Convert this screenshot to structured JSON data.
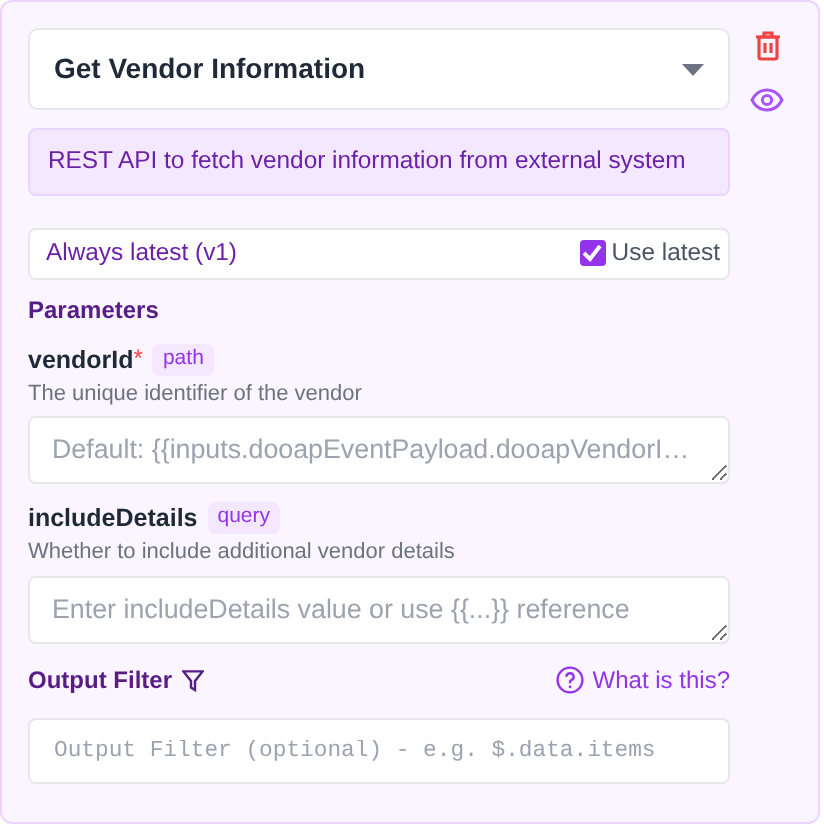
{
  "operation": {
    "title": "Get Vendor Information",
    "description": "REST API to fetch vendor information from external system"
  },
  "version": {
    "label": "Always latest (v1)",
    "use_latest": {
      "label": "Use latest",
      "checked": true
    }
  },
  "parameters": {
    "heading": "Parameters",
    "items": [
      {
        "name": "vendorId",
        "required_mark": "*",
        "location": "path",
        "description": "The unique identifier of the vendor",
        "placeholder": "Default: {{inputs.dooapEventPayload.dooapVendorI…"
      },
      {
        "name": "includeDetails",
        "location": "query",
        "description": "Whether to include additional vendor details",
        "placeholder": "Enter includeDetails value or use {{...}} reference"
      }
    ]
  },
  "output_filter": {
    "label": "Output Filter",
    "help": "What is this?",
    "placeholder": "Output Filter (optional) - e.g. $.data.items"
  }
}
